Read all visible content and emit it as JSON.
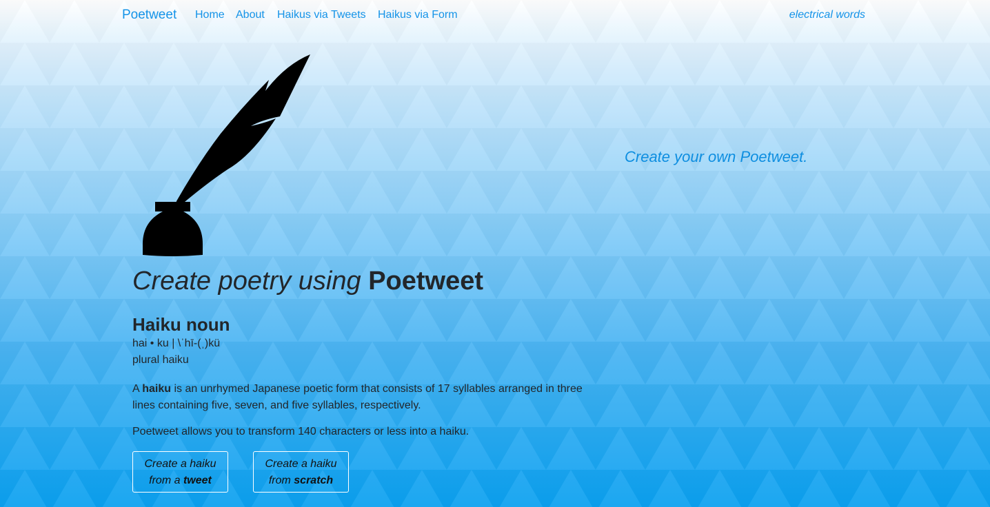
{
  "navbar": {
    "brand": "Poetweet",
    "links": [
      "Home",
      "About",
      "Haikus via Tweets",
      "Haikus via Form"
    ],
    "tagline": "electrical words"
  },
  "hero": {
    "icon": "quill-inkwell-icon",
    "headline_lead": "Create poetry using ",
    "headline_brand": "Poetweet",
    "term": "Haiku",
    "part_of_speech": " noun",
    "pronunciation": "hai • ku | \\ˈhī-(ˌ)kü",
    "plural": "plural haiku",
    "definition_prefix": "A ",
    "definition_term": "haiku",
    "definition_rest": " is an unrhymed Japanese poetic form that consists of 17 syllables arranged in three lines containing five, seven, and five syllables, respectively.",
    "allows": "Poetweet allows you to transform 140 characters or less into a haiku."
  },
  "buttons": {
    "tweet_line1": "Create a haiku",
    "tweet_line2_prefix": "from a ",
    "tweet_line2_bold": "tweet",
    "scratch_line1": "Create a haiku",
    "scratch_line2_prefix": "from ",
    "scratch_line2_bold": "scratch"
  },
  "side": {
    "cta": "Create your own Poetweet."
  },
  "colors": {
    "link": "#1493e8",
    "bg_top": "#ffffff",
    "bg_bottom": "#0aa0f0"
  }
}
